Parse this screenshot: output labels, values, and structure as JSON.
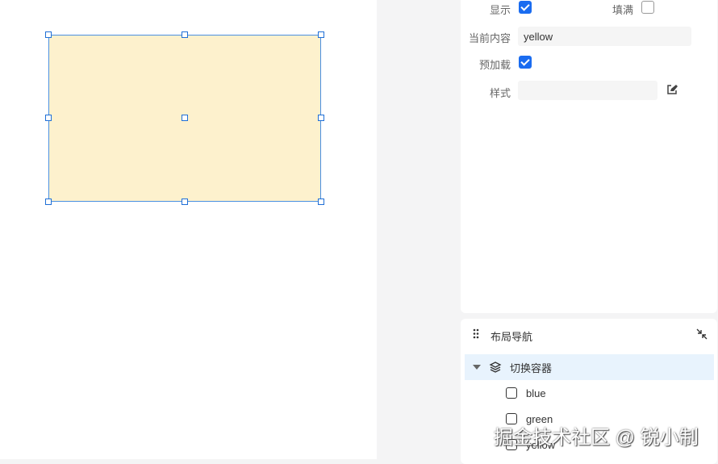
{
  "props": {
    "show_label": "显示",
    "fill_label": "填满",
    "content_label": "当前内容",
    "content_value": "yellow",
    "preload_label": "预加载",
    "style_label": "样式",
    "style_value": "",
    "show_checked": true,
    "fill_checked": false,
    "preload_checked": true
  },
  "nav": {
    "title": "布局导航",
    "root": "切换容器",
    "children": [
      "blue",
      "green",
      "yellow"
    ]
  },
  "watermark": "掘金技术社区 @ 锐小制"
}
